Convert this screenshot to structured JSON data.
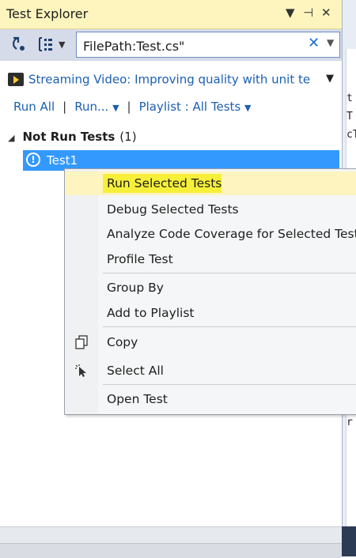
{
  "window": {
    "title": "Test Explorer",
    "title_buttons": [
      "▼",
      "⊣",
      "✕"
    ]
  },
  "toolbar": {
    "search_value": "FilePath:Test.cs\"",
    "clear_glyph": "✕",
    "drop_glyph": "▼"
  },
  "promo": {
    "text": "Streaming Video: Improving quality with unit te",
    "caret": "▼"
  },
  "runbar": {
    "run_all": "Run All",
    "run": "Run...",
    "playlist": "Playlist : All Tests",
    "separator": "|"
  },
  "group": {
    "name": "Not Run Tests",
    "count": "(1)"
  },
  "test": {
    "name": "Test1"
  },
  "context_menu": {
    "items": [
      {
        "label": "Run Selected Tests",
        "icon": ""
      },
      {
        "label": "Debug Selected Tests",
        "icon": ""
      },
      {
        "label": "Analyze Code Coverage for Selected Tests",
        "icon": ""
      },
      {
        "label": "Profile Test",
        "icon": ""
      },
      {
        "label": "Group By",
        "icon": ""
      },
      {
        "label": "Add to Playlist",
        "icon": ""
      },
      {
        "label": "Copy",
        "icon": "copy-icon"
      },
      {
        "label": "Select All",
        "icon": "select-all-icon"
      },
      {
        "label": "Open Test",
        "icon": ""
      }
    ]
  },
  "editor_fragments": [
    "t",
    "T",
    "cT",
    "r"
  ]
}
